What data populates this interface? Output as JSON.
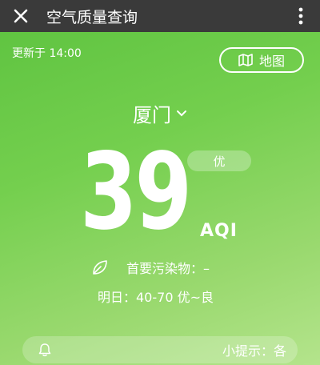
{
  "titlebar": {
    "title": "空气质量查询",
    "close_icon": "close-icon",
    "more_icon": "more-vertical-icon"
  },
  "header": {
    "updated_text": "更新于 14:00",
    "map_button_label": "地图",
    "map_icon": "map-icon"
  },
  "city": {
    "name": "厦门",
    "dropdown_icon": "chevron-down-icon"
  },
  "aqi": {
    "value": "39",
    "level": "优",
    "label": "AQI"
  },
  "pollutant": {
    "icon": "leaf-icon",
    "text": "首要污染物：–"
  },
  "forecast": {
    "text": "明日：40-70  优~良"
  },
  "tip": {
    "icon": "bell-icon",
    "text": "小提示：各"
  },
  "colors": {
    "titlebar_bg": "#3a3a3a",
    "gradient_top": "#5cc23f",
    "gradient_bottom": "#b4e48c",
    "text": "#ffffff"
  }
}
